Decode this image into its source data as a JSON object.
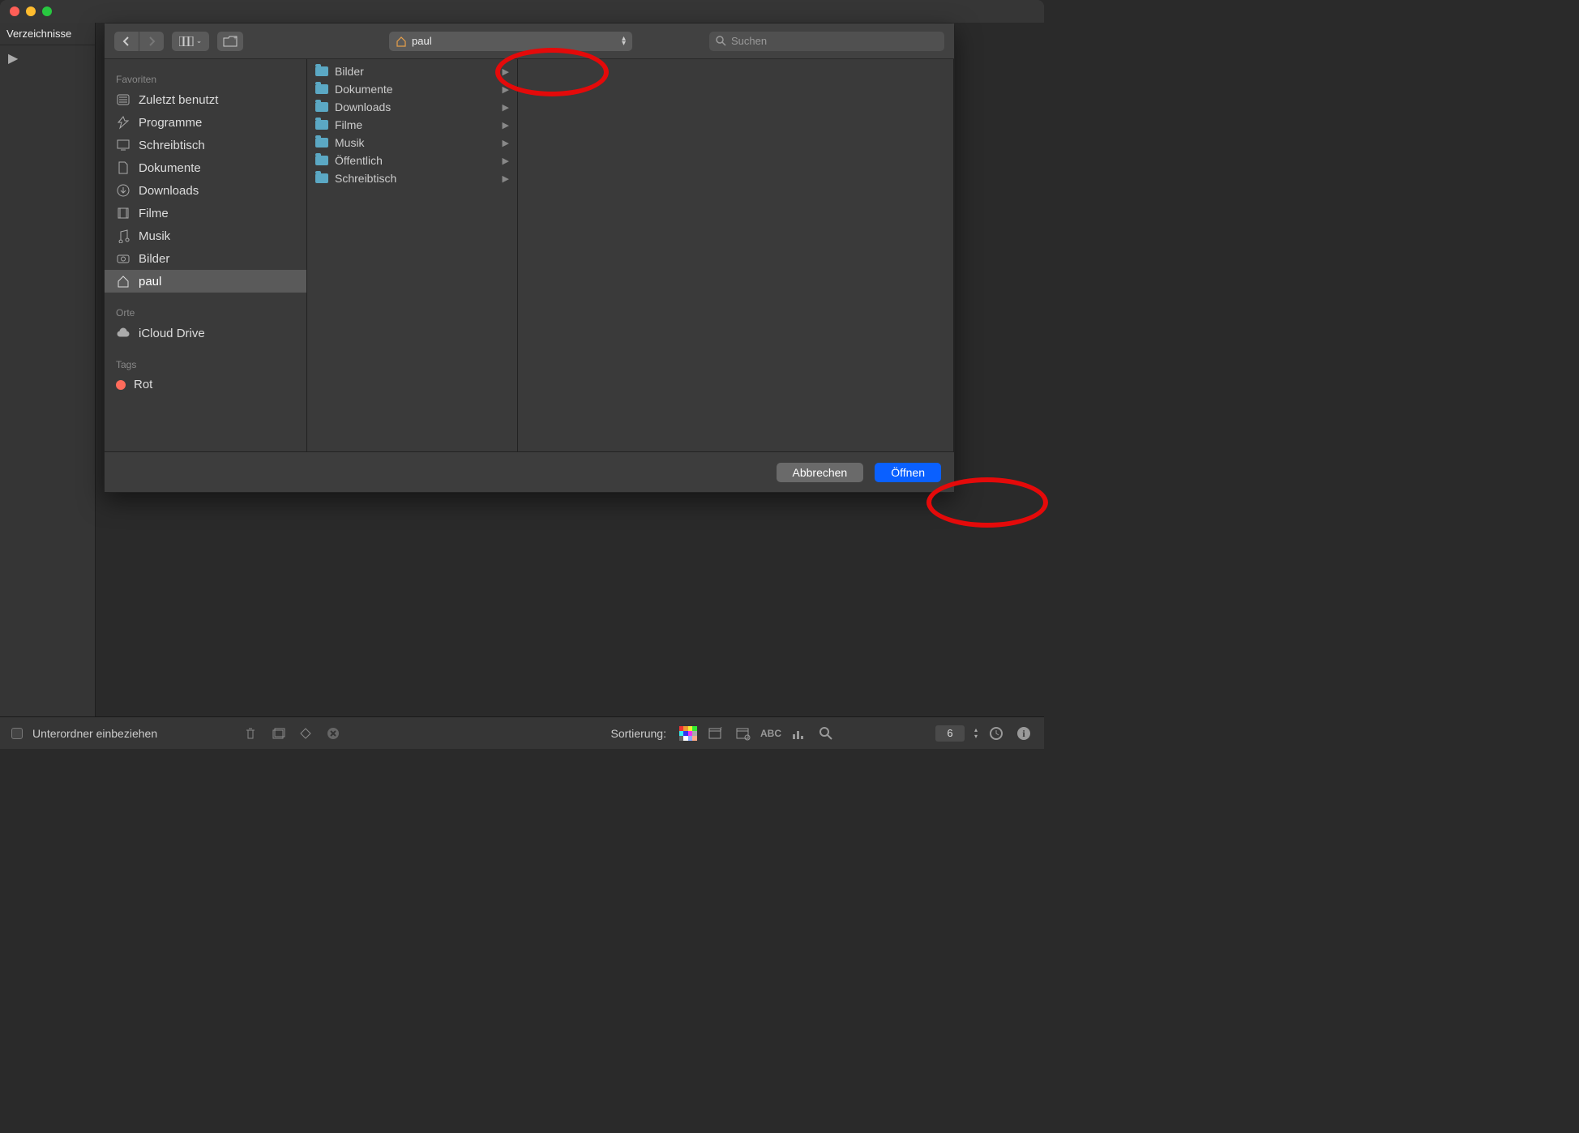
{
  "left_panel": {
    "header": "Verzeichnisse"
  },
  "dialog": {
    "path_dropdown": {
      "label": "paul"
    },
    "search": {
      "placeholder": "Suchen"
    },
    "sidebar": {
      "favorites_label": "Favoriten",
      "favorites": [
        {
          "icon": "clock",
          "label": "Zuletzt benutzt"
        },
        {
          "icon": "app",
          "label": "Programme"
        },
        {
          "icon": "desktop",
          "label": "Schreibtisch"
        },
        {
          "icon": "doc",
          "label": "Dokumente"
        },
        {
          "icon": "download",
          "label": "Downloads"
        },
        {
          "icon": "film",
          "label": "Filme"
        },
        {
          "icon": "music",
          "label": "Musik"
        },
        {
          "icon": "camera",
          "label": "Bilder"
        },
        {
          "icon": "home",
          "label": "paul",
          "selected": true
        }
      ],
      "locations_label": "Orte",
      "locations": [
        {
          "icon": "cloud",
          "label": "iCloud Drive"
        }
      ],
      "tags_label": "Tags",
      "tags": [
        {
          "color": "#ff6b5b",
          "label": "Rot"
        }
      ]
    },
    "column_items": [
      "Bilder",
      "Dokumente",
      "Downloads",
      "Filme",
      "Musik",
      "Öffentlich",
      "Schreibtisch"
    ],
    "buttons": {
      "cancel": "Abbrechen",
      "open": "Öffnen"
    }
  },
  "bottom_bar": {
    "include_subfolders": "Unterordner einbeziehen",
    "sort_label": "Sortierung:",
    "abc": "ABC",
    "count": "6"
  }
}
